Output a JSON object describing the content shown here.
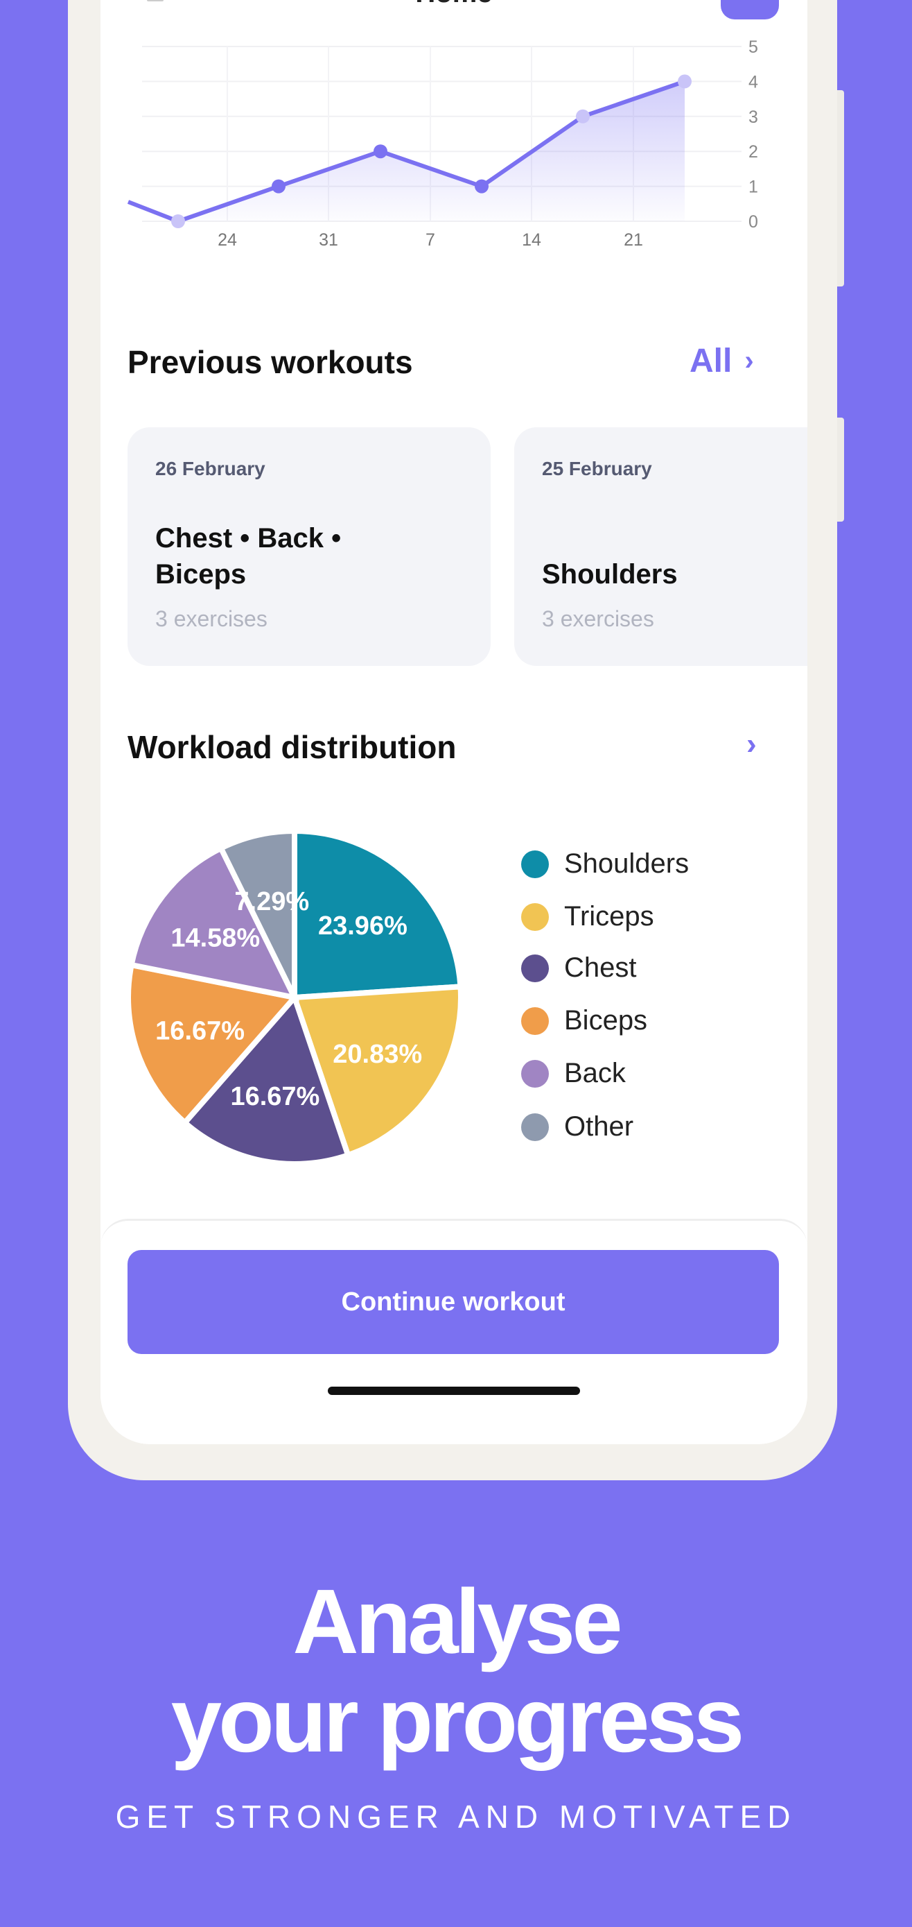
{
  "header": {
    "title": "Home",
    "menu_icon": "hamburger-icon",
    "action_icon": "profile-button"
  },
  "chart_data": [
    {
      "type": "area",
      "x": [
        "20 Jan",
        "27 Jan",
        "3 Feb",
        "10 Feb",
        "17 Feb",
        "24 Feb"
      ],
      "values": [
        0,
        1,
        2,
        1,
        3,
        4
      ],
      "ylim": [
        0,
        5
      ],
      "y_ticks": [
        "0",
        "1",
        "2",
        "3",
        "4",
        "5"
      ],
      "x_ticks": [
        {
          "day": "24",
          "month": "Jan"
        },
        {
          "day": "31",
          "month": "Jan"
        },
        {
          "day": "7",
          "month": "Feb"
        },
        {
          "day": "14",
          "month": "Feb"
        },
        {
          "day": "21",
          "month": "Feb"
        }
      ],
      "grid": true,
      "color": "#7B71F1"
    },
    {
      "type": "pie",
      "title": "Workload distribution",
      "legend": "right",
      "slices": [
        {
          "name": "Shoulders",
          "value": 23.96,
          "label": "23.96%",
          "color": "#0E8DA8"
        },
        {
          "name": "Triceps",
          "value": 20.83,
          "label": "20.83%",
          "color": "#F1C453"
        },
        {
          "name": "Chest",
          "value": 16.67,
          "label": "16.67%",
          "color": "#5C4F8E"
        },
        {
          "name": "Biceps",
          "value": 16.67,
          "label": "16.67%",
          "color": "#F09D4A"
        },
        {
          "name": "Back",
          "value": 14.58,
          "label": "14.58%",
          "color": "#A085C3"
        },
        {
          "name": "Other",
          "value": 7.29,
          "label": "7.29%",
          "color": "#8E9AAE"
        }
      ]
    }
  ],
  "previous": {
    "title": "Previous workouts",
    "all_label": "All",
    "cards": [
      {
        "date": "26 February",
        "name": "Chest • Back • Biceps",
        "count": "3 exercises"
      },
      {
        "date": "25 February",
        "name": "Shoulders",
        "count": "3 exercises"
      }
    ]
  },
  "workload": {
    "title": "Workload distribution"
  },
  "cta": {
    "label": "Continue workout"
  },
  "promo": {
    "line1": "Analyse",
    "line2": "your progress",
    "subtitle": "GET STRONGER AND MOTIVATED"
  }
}
